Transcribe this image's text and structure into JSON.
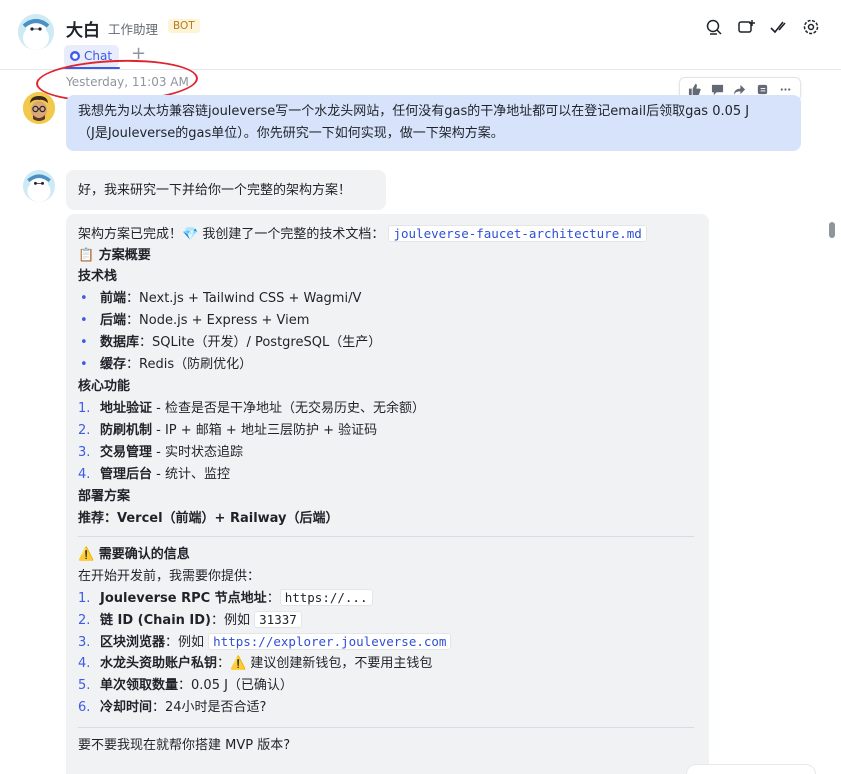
{
  "header": {
    "title": "大白",
    "subtitle": "工作助理",
    "badge": "BOT",
    "tab_label": "Chat",
    "add_tab": "+"
  },
  "timestamp": "Yesterday, 11:03 AM",
  "user_message": {
    "line1": "我想先为以太坊兼容链jouleverse写一个水龙头网站，任何没有gas的干净地址都可以在登记email后领取gas 0.05 J",
    "line2": "（J是Jouleverse的gas单位）。你先研究一下如何实现，做一下架构方案。"
  },
  "bot_reply1": "好，我来研究一下并给你一个完整的架构方案！",
  "bot_reply2": {
    "intro": "架构方案已完成！💎 我创建了一个完整的技术文档：",
    "doc_file": "jouleverse-faucet-architecture.md",
    "overview_heading": "📋 方案概要",
    "tech_stack_heading": "技术栈",
    "tech_stack": [
      {
        "label": "前端",
        "value": "：Next.js + Tailwind CSS + Wagmi/V"
      },
      {
        "label": "后端",
        "value": "：Node.js + Express + Viem"
      },
      {
        "label": "数据库",
        "value": "：SQLite（开发）/ PostgreSQL（生产）"
      },
      {
        "label": "缓存",
        "value": "：Redis（防刷优化）"
      }
    ],
    "core_heading": "核心功能",
    "core_features": [
      {
        "num": "1.",
        "label": "地址验证",
        "value": " - 检查是否是干净地址（无交易历史、无余额）"
      },
      {
        "num": "2.",
        "label": "防刷机制",
        "value": " - IP + 邮箱 + 地址三层防护 + 验证码"
      },
      {
        "num": "3.",
        "label": "交易管理",
        "value": " - 实时状态追踪"
      },
      {
        "num": "4.",
        "label": "管理后台",
        "value": " - 统计、监控"
      }
    ],
    "deploy_heading": "部署方案",
    "deploy_recommend": "推荐：Vercel（前端）+ Railway（后端）",
    "confirm_heading": "⚠️ 需要确认的信息",
    "confirm_intro": "在开始开发前，我需要你提供：",
    "confirm_items": [
      {
        "num": "1.",
        "label": "Jouleverse RPC 节点地址",
        "value": "：",
        "code": "https://..."
      },
      {
        "num": "2.",
        "label": "链 ID (Chain ID)",
        "value": "：例如 ",
        "code": "31337"
      },
      {
        "num": "3.",
        "label": "区块浏览器",
        "value": "：例如 ",
        "code": "https://explorer.jouleverse.com"
      },
      {
        "num": "4.",
        "label": "水龙头资助账户私钥",
        "value": "：⚠️ 建议创建新钱包，不要用主钱包"
      },
      {
        "num": "5.",
        "label": "单次领取数量",
        "value": "：0.05 J（已确认）"
      },
      {
        "num": "6.",
        "label": "冷却时间",
        "value": "：24小时是否合适?"
      }
    ],
    "closing": "要不要我现在就帮你搭建 MVP 版本?"
  },
  "colors": {
    "accent": "#3c5ce6",
    "user_bubble": "#d6e3fb",
    "bot_bubble": "#f1f2f4",
    "annotation": "#e0242f"
  }
}
